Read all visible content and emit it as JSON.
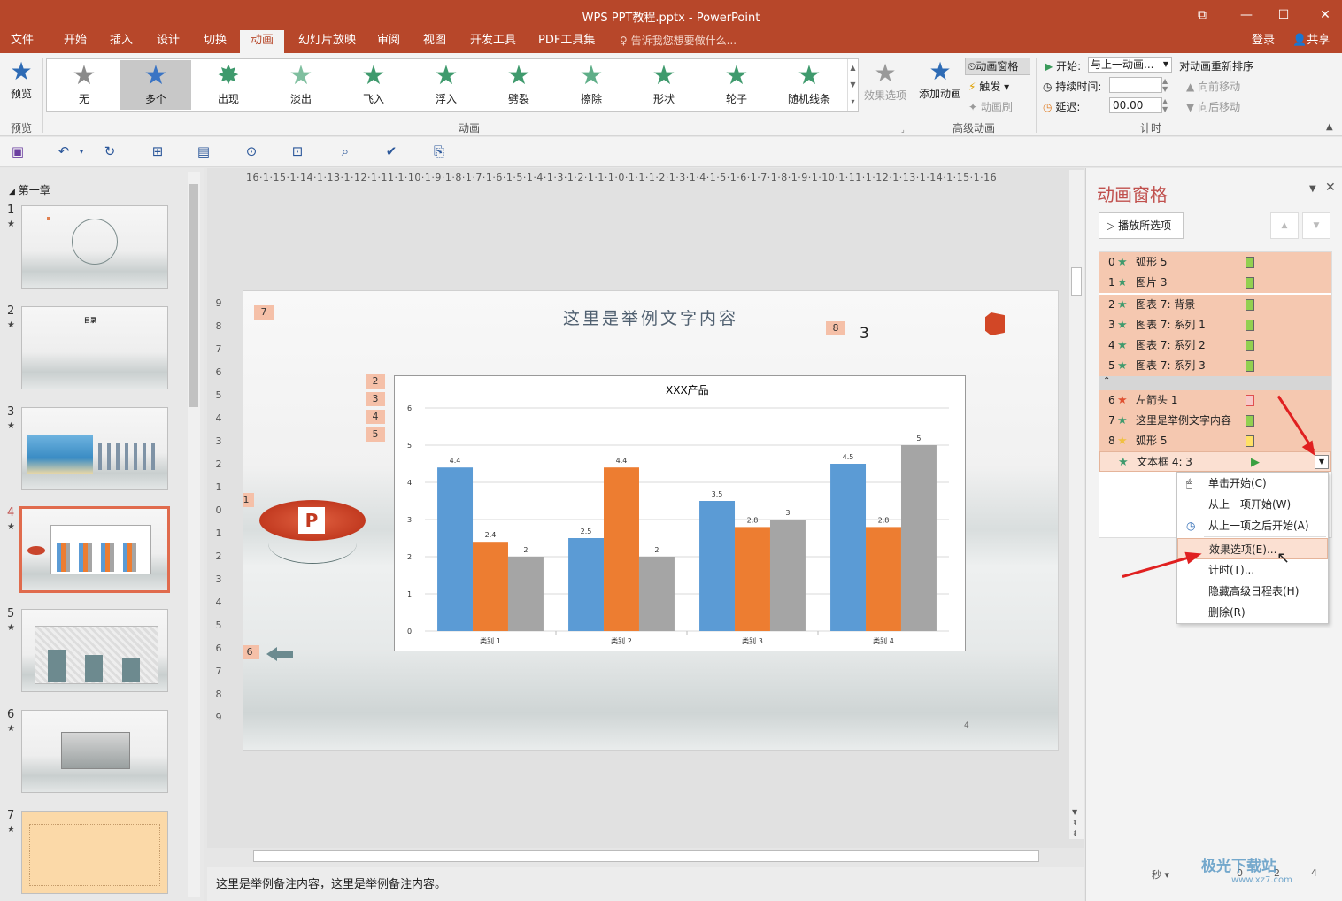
{
  "window": {
    "title": "WPS PPT教程.pptx - PowerPoint",
    "controls": [
      "restore-ribbon-icon",
      "minimize-icon",
      "maximize-icon",
      "close-icon"
    ]
  },
  "tabs": [
    "文件",
    "开始",
    "插入",
    "设计",
    "切换",
    "动画",
    "幻灯片放映",
    "审阅",
    "视图",
    "开发工具",
    "PDF工具集"
  ],
  "active_tab": "动画",
  "tellme": "告诉我您想要做什么...",
  "account": {
    "login": "登录",
    "share": "共享"
  },
  "ribbon": {
    "preview": "预览",
    "preview_group": "预览",
    "animations": [
      "无",
      "多个",
      "出现",
      "淡出",
      "飞入",
      "浮入",
      "劈裂",
      "擦除",
      "形状",
      "轮子",
      "随机线条"
    ],
    "selected_animation": "多个",
    "effect_options": "效果选项",
    "animation_group": "动画",
    "add_animation": "添加动画",
    "animation_pane": "动画窗格",
    "trigger": "触发",
    "animation_painter": "动画刷",
    "advanced_group": "高级动画",
    "start_label": "开始:",
    "start_value": "与上一动画...",
    "duration_label": "持续时间:",
    "duration_value": "",
    "delay_label": "延迟:",
    "delay_value": "00.00",
    "reorder": "对动画重新排序",
    "move_earlier": "向前移动",
    "move_later": "向后移动",
    "timing_group": "计时"
  },
  "thumbnails": {
    "section": "第一章",
    "items": [
      {
        "num": "1",
        "title": ""
      },
      {
        "num": "2",
        "title": "目录"
      },
      {
        "num": "3",
        "title": ""
      },
      {
        "num": "4",
        "title": ""
      },
      {
        "num": "5",
        "title": ""
      },
      {
        "num": "6",
        "title": ""
      },
      {
        "num": "7",
        "title": ""
      }
    ],
    "selected": "4"
  },
  "ruler": {
    "horizontal": "16·1·15·1·14·1·13·1·12·1·11·1·10·1·9·1·8·1·7·1·6·1·5·1·4·1·3·1·2·1·1·1·0·1·1·1·2·1·3·1·4·1·5·1·6·1·7·1·8·1·9·1·10·1·11·1·12·1·13·1·14·1·15·1·16",
    "vertical": [
      "9",
      "8",
      "7",
      "6",
      "5",
      "4",
      "3",
      "2",
      "1",
      "0",
      "1",
      "2",
      "3",
      "4",
      "5",
      "6",
      "7",
      "8",
      "9"
    ]
  },
  "slide": {
    "title": "这里是举例文字内容",
    "textbox_value": "3",
    "page_number": "4",
    "badges": [
      "7",
      "8",
      "2",
      "3",
      "4",
      "5",
      "1",
      "6"
    ]
  },
  "chart_data": {
    "type": "bar",
    "title": "XXX产品",
    "categories": [
      "类别 1",
      "类别 2",
      "类别 3",
      "类别 4"
    ],
    "series": [
      {
        "values": [
          4.4,
          2.5,
          3.5,
          4.5
        ],
        "color": "#5b9bd5"
      },
      {
        "values": [
          2.4,
          4.4,
          2.8,
          2.8
        ],
        "color": "#ed7d31"
      },
      {
        "values": [
          2,
          2,
          3,
          5
        ],
        "color": "#a5a5a5"
      }
    ],
    "ylim": [
      0,
      6
    ],
    "yticks": [
      "0",
      "1",
      "2",
      "3",
      "4",
      "5",
      "6"
    ],
    "grid": true,
    "data_labels": true
  },
  "notes": "这里是举例备注内容，这里是举例备注内容。",
  "pane": {
    "title": "动画窗格",
    "play_button": "播放所选项",
    "rows": [
      {
        "num": "0",
        "name": "弧形 5",
        "star": "green",
        "bar": "green"
      },
      {
        "num": "1",
        "name": "图片 3",
        "star": "green",
        "bar": "green"
      },
      {
        "num": "2",
        "name": "图表 7: 背景",
        "star": "green",
        "bar": "green"
      },
      {
        "num": "3",
        "name": "图表 7: 系列 1",
        "star": "green",
        "bar": "green"
      },
      {
        "num": "4",
        "name": "图表 7: 系列 2",
        "star": "green",
        "bar": "green"
      },
      {
        "num": "5",
        "name": "图表 7: 系列 3",
        "star": "green",
        "bar": "green"
      },
      {
        "num": "6",
        "name": "左箭头 1",
        "star": "red",
        "bar": "red"
      },
      {
        "num": "7",
        "name": "这里是举例文字内容",
        "star": "green",
        "bar": "green"
      },
      {
        "num": "8",
        "name": "弧形 5",
        "star": "yellow",
        "bar": "yellow"
      },
      {
        "num": "",
        "name": "文本框 4: 3",
        "star": "green",
        "bar": "play"
      }
    ],
    "menu": [
      "单击开始(C)",
      "从上一项开始(W)",
      "从上一项之后开始(A)",
      "效果选项(E)...",
      "计时(T)...",
      "隐藏高级日程表(H)",
      "删除(R)"
    ],
    "highlighted_menu": "效果选项(E)...",
    "seconds_label": "秒",
    "timeline": [
      "0",
      "2",
      "4"
    ]
  },
  "watermark": {
    "text": "极光下载站",
    "url": "www.xz7.com"
  }
}
